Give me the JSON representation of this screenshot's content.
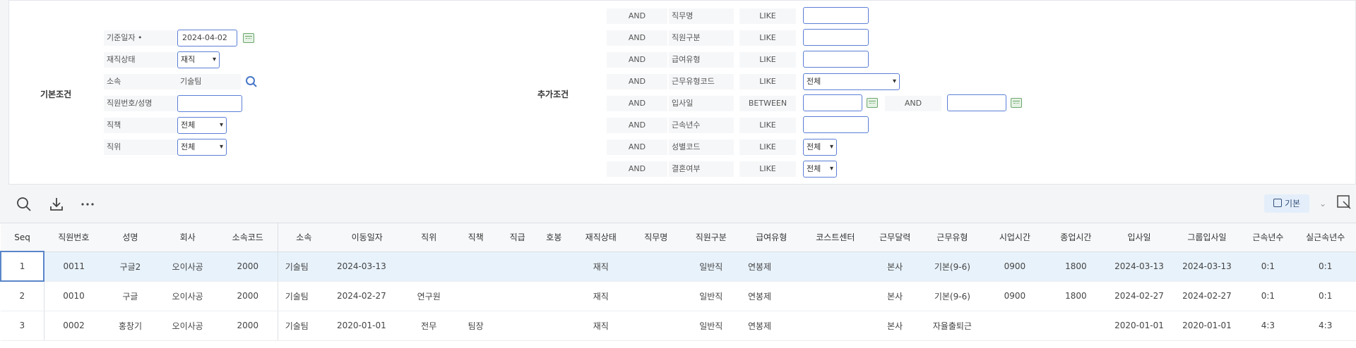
{
  "basic": {
    "section_title": "기본조건",
    "fields": {
      "base_date": {
        "label": "기준일자 •",
        "value": "2024-04-02"
      },
      "status": {
        "label": "재직상태",
        "value": "재직"
      },
      "dept": {
        "label": "소속",
        "value": "기술팀"
      },
      "emp": {
        "label": "직원번호/성명",
        "value": ""
      },
      "duty": {
        "label": "직책",
        "value": "전체"
      },
      "rank": {
        "label": "직위",
        "value": "전체"
      }
    }
  },
  "extra": {
    "section_title": "추가조건",
    "rows": [
      {
        "and": "AND",
        "label": "직무명",
        "op": "LIKE",
        "value": ""
      },
      {
        "and": "AND",
        "label": "직원구분",
        "op": "LIKE",
        "value": ""
      },
      {
        "and": "AND",
        "label": "급여유형",
        "op": "LIKE",
        "value": ""
      },
      {
        "and": "AND",
        "label": "근무유형코드",
        "op": "LIKE",
        "value": "전체"
      },
      {
        "and": "AND",
        "label": "입사일",
        "op": "BETWEEN",
        "value": "",
        "and2": "AND",
        "value2": ""
      },
      {
        "and": "AND",
        "label": "근속년수",
        "op": "LIKE",
        "value": ""
      },
      {
        "and": "AND",
        "label": "성별코드",
        "op": "LIKE",
        "value": "전체"
      },
      {
        "and": "AND",
        "label": "결혼여부",
        "op": "LIKE",
        "value": "전체"
      }
    ]
  },
  "toolbar": {
    "basic_label": "기본"
  },
  "grid": {
    "headers": [
      "Seq",
      "직원번호",
      "성명",
      "회사",
      "소속코드",
      "소속",
      "이동일자",
      "직위",
      "직책",
      "직급",
      "호봉",
      "재직상태",
      "직무명",
      "직원구분",
      "급여유형",
      "코스트센터",
      "근무달력",
      "근무유형",
      "시업시간",
      "종업시간",
      "입사일",
      "그룹입사일",
      "근속년수",
      "실근속년수"
    ],
    "rows": [
      [
        "1",
        "0011",
        "구글2",
        "오이사공",
        "2000",
        "기술팀",
        "2024-03-13",
        "",
        "",
        "",
        "",
        "재직",
        "",
        "일반직",
        "연봉제",
        "",
        "본사",
        "기본(9-6)",
        "0900",
        "1800",
        "2024-03-13",
        "2024-03-13",
        "0:1",
        "0:1"
      ],
      [
        "2",
        "0010",
        "구글",
        "오이사공",
        "2000",
        "기술팀",
        "2024-02-27",
        "연구원",
        "",
        "",
        "",
        "재직",
        "",
        "일반직",
        "연봉제",
        "",
        "본사",
        "기본(9-6)",
        "0900",
        "1800",
        "2024-02-27",
        "2024-02-27",
        "0:1",
        "0:1"
      ],
      [
        "3",
        "0002",
        "홍창기",
        "오이사공",
        "2000",
        "기술팀",
        "2020-01-01",
        "전무",
        "팀장",
        "",
        "",
        "재직",
        "",
        "일반직",
        "연봉제",
        "",
        "본사",
        "자율출퇴근",
        "",
        "",
        "2020-01-01",
        "2020-01-01",
        "4:3",
        "4:3"
      ]
    ]
  },
  "colors": {
    "accent": "#5b7fd6",
    "selected_row": "#e8f2fb"
  }
}
